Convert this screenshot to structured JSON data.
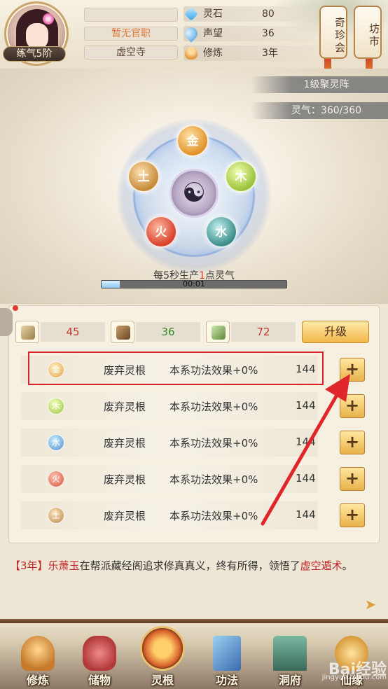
{
  "player": {
    "rank": "练气5阶",
    "title": "暂无官职",
    "sect": "虚空寺"
  },
  "stats": [
    {
      "label": "灵石",
      "value": "80",
      "icon": "spirit-stone-icon"
    },
    {
      "label": "声望",
      "value": "36",
      "icon": "fame-flame-icon"
    },
    {
      "label": "修炼",
      "value": "3年",
      "icon": "cultivation-icon"
    }
  ],
  "side_buttons": {
    "qizhen": "奇珍会",
    "fangshi": "坊市"
  },
  "formation": {
    "array_name": "1级聚灵阵",
    "qi_label": "灵气：360/360",
    "elements": {
      "gold": "金",
      "wood": "木",
      "earth": "土",
      "fire": "火",
      "water": "水"
    },
    "center_symbol": "☯",
    "production_prefix": "每5秒生产",
    "production_amount": "1",
    "production_suffix": "点灵气",
    "timer": "00:01",
    "progress": 0.1
  },
  "resources": [
    {
      "value": "45",
      "icon": "scroll-icon",
      "color": "#c23a2a"
    },
    {
      "value": "36",
      "icon": "wood-bundle-icon",
      "color": "#2f8a2a"
    },
    {
      "value": "72",
      "icon": "herb-icon",
      "color": "#c23a2a"
    }
  ],
  "upgrade_label": "升级",
  "roots": [
    {
      "element": "金",
      "name": "废弃灵根",
      "effect": "本系功法效果+0%",
      "cost": "144"
    },
    {
      "element": "木",
      "name": "废弃灵根",
      "effect": "本系功法效果+0%",
      "cost": "144"
    },
    {
      "element": "水",
      "name": "废弃灵根",
      "effect": "本系功法效果+0%",
      "cost": "144"
    },
    {
      "element": "火",
      "name": "废弃灵根",
      "effect": "本系功法效果+0%",
      "cost": "144"
    },
    {
      "element": "土",
      "name": "废弃灵根",
      "effect": "本系功法效果+0%",
      "cost": "144"
    }
  ],
  "plus_label": "+",
  "log": {
    "year": "【3年】",
    "actor": "乐萧玉",
    "text": "在帮派藏经阁追求修真真义，终有所得，领悟了",
    "skill": "虚空遁术",
    "end": "。"
  },
  "nav": [
    {
      "label": "修炼",
      "icon": "monk-icon"
    },
    {
      "label": "储物",
      "icon": "treasure-bag-icon"
    },
    {
      "label": "灵根",
      "icon": "spirit-root-icon"
    },
    {
      "label": "功法",
      "icon": "book-icon"
    },
    {
      "label": "洞府",
      "icon": "cave-house-icon"
    },
    {
      "label": "仙缘",
      "icon": "fortune-icon"
    }
  ],
  "watermark": "Bai经验",
  "watermark_sub": "jingyan.baidu.com",
  "colors": {
    "accent_red": "#d8232a",
    "gold_button": "#f2b84a",
    "panel_bg": "#f6f0e2"
  }
}
